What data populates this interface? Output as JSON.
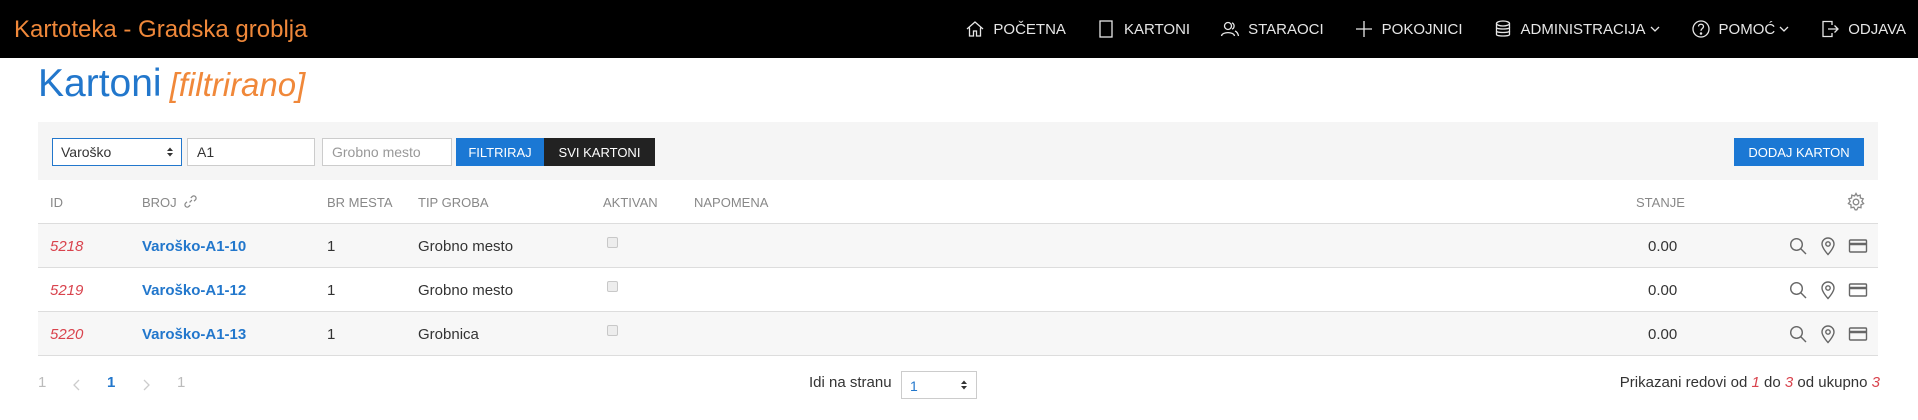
{
  "app": {
    "title": "Kartoteka - Gradska groblja"
  },
  "nav": {
    "items": [
      {
        "label": "Početna",
        "icon": "home-icon"
      },
      {
        "label": "Kartoni",
        "icon": "card-icon"
      },
      {
        "label": "Staraoci",
        "icon": "users-icon"
      },
      {
        "label": "Pokojnici",
        "icon": "plus-icon"
      },
      {
        "label": "Administracija",
        "icon": "database-icon",
        "dropdown": true
      },
      {
        "label": "Pomoć",
        "icon": "help-icon",
        "dropdown": true
      },
      {
        "label": "Odjava",
        "icon": "logout-icon"
      }
    ]
  },
  "page": {
    "title": "Kartoni",
    "filter_tag": "[filtrirano]"
  },
  "filters": {
    "cemetery_select": "Varoško",
    "field_value": "A1",
    "grave_placeholder": "Grobno mesto",
    "filter_button": "Filtriraj",
    "all_button": "Svi kartoni",
    "add_button": "Dodaj karton"
  },
  "table": {
    "columns": {
      "id": "ID",
      "broj": "BROJ",
      "br_mesta": "BR MESTA",
      "tip_groba": "TIP GROBA",
      "aktivan": "AKTIVAN",
      "napomena": "NAPOMENA",
      "stanje": "STANJE"
    },
    "rows": [
      {
        "id": "5218",
        "broj": "Varoško-A1-10",
        "br_mesta": "1",
        "tip_groba": "Grobno mesto",
        "aktivan": false,
        "napomena": "",
        "stanje": "0.00"
      },
      {
        "id": "5219",
        "broj": "Varoško-A1-12",
        "br_mesta": "1",
        "tip_groba": "Grobno mesto",
        "aktivan": false,
        "napomena": "",
        "stanje": "0.00"
      },
      {
        "id": "5220",
        "broj": "Varoško-A1-13",
        "br_mesta": "1",
        "tip_groba": "Grobnica",
        "aktivan": false,
        "napomena": "",
        "stanje": "0.00"
      }
    ]
  },
  "pagination": {
    "first": "1",
    "current": "1",
    "last": "1",
    "goto_label": "Idi na stranu",
    "goto_value": "1"
  },
  "summary": {
    "prefix": "Prikazani redovi od",
    "from": "1",
    "to_label": "do",
    "to": "3",
    "total_label": "od ukupno",
    "total": "3"
  },
  "colors": {
    "accent": "#2277cc",
    "brand": "#f0883a",
    "id_red": "#d9434d",
    "button_blue": "#1b78d4"
  }
}
